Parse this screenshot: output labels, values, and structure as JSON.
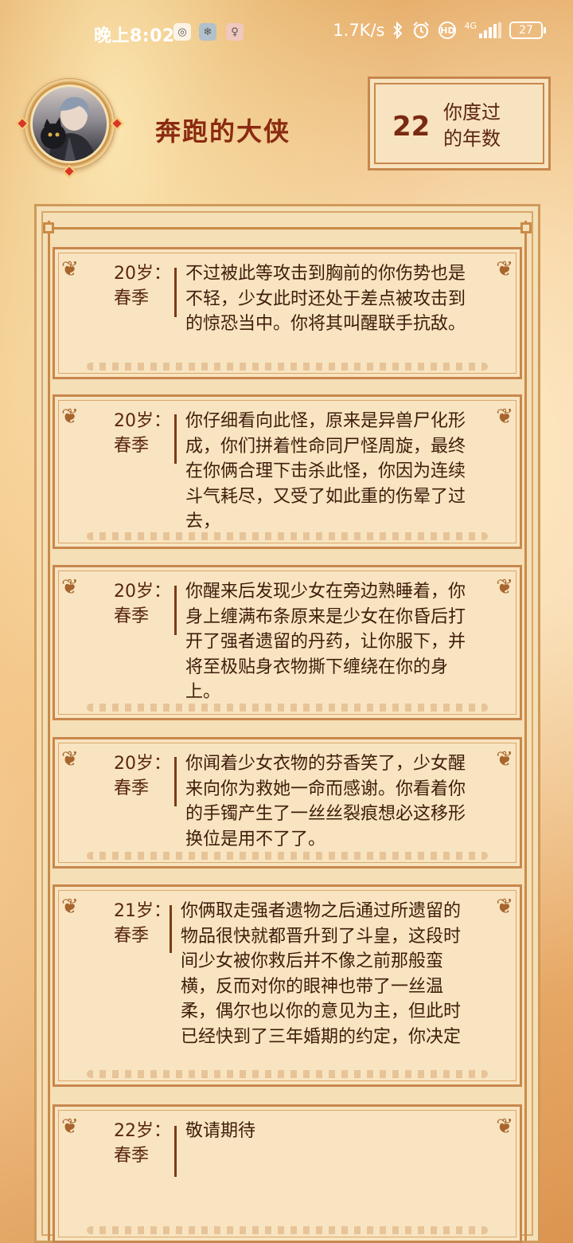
{
  "status_bar": {
    "time": "晚上8:02",
    "network_speed": "1.7K/s",
    "network_type": "4G",
    "battery": "27",
    "icons": [
      "app-notification-icon",
      "map-notification-icon",
      "lock-notification-icon",
      "bluetooth-icon",
      "alarm-icon",
      "hd-icon",
      "signal-icon",
      "battery-icon"
    ]
  },
  "header": {
    "player_name": "奔跑的大侠",
    "years_value": "22",
    "years_label": "你度过的年数"
  },
  "colors": {
    "accent_brown": "#8a2a10",
    "frame_border": "#c8874d",
    "panel_bg": "#f5dfb6",
    "text": "#3e1d0b"
  },
  "timeline": [
    {
      "age": "20岁：",
      "season": "春季",
      "text": "不过被此等攻击到胸前的你伤势也是不轻，少女此时还处于差点被攻击到的惊恐当中。你将其叫醒联手抗敌。"
    },
    {
      "age": "20岁：",
      "season": "春季",
      "text": "你仔细看向此怪，原来是异兽尸化形成，你们拼着性命同尸怪周旋，最终在你俩合理下击杀此怪，你因为连续斗气耗尽，又受了如此重的伤晕了过去，"
    },
    {
      "age": "20岁：",
      "season": "春季",
      "text": "你醒来后发现少女在旁边熟睡着，你身上缠满布条原来是少女在你昏后打开了强者遗留的丹药，让你服下，并将至极贴身衣物撕下缠绕在你的身上。"
    },
    {
      "age": "20岁：",
      "season": "春季",
      "text": "你闻着少女衣物的芬香笑了，少女醒来向你为救她一命而感谢。你看着你的手镯产生了一丝丝裂痕想必这移形换位是用不了了。"
    },
    {
      "age": "21岁：",
      "season": "春季",
      "text": "你俩取走强者遗物之后通过所遗留的物品很快就都晋升到了斗皇，这段时间少女被你救后并不像之前那般蛮横，反而对你的眼神也带了一丝温柔，偶尔也以你的意见为主，但此时已经快到了三年婚期的约定，你决定"
    },
    {
      "age": "22岁：",
      "season": "春季",
      "text": "敬请期待"
    }
  ]
}
